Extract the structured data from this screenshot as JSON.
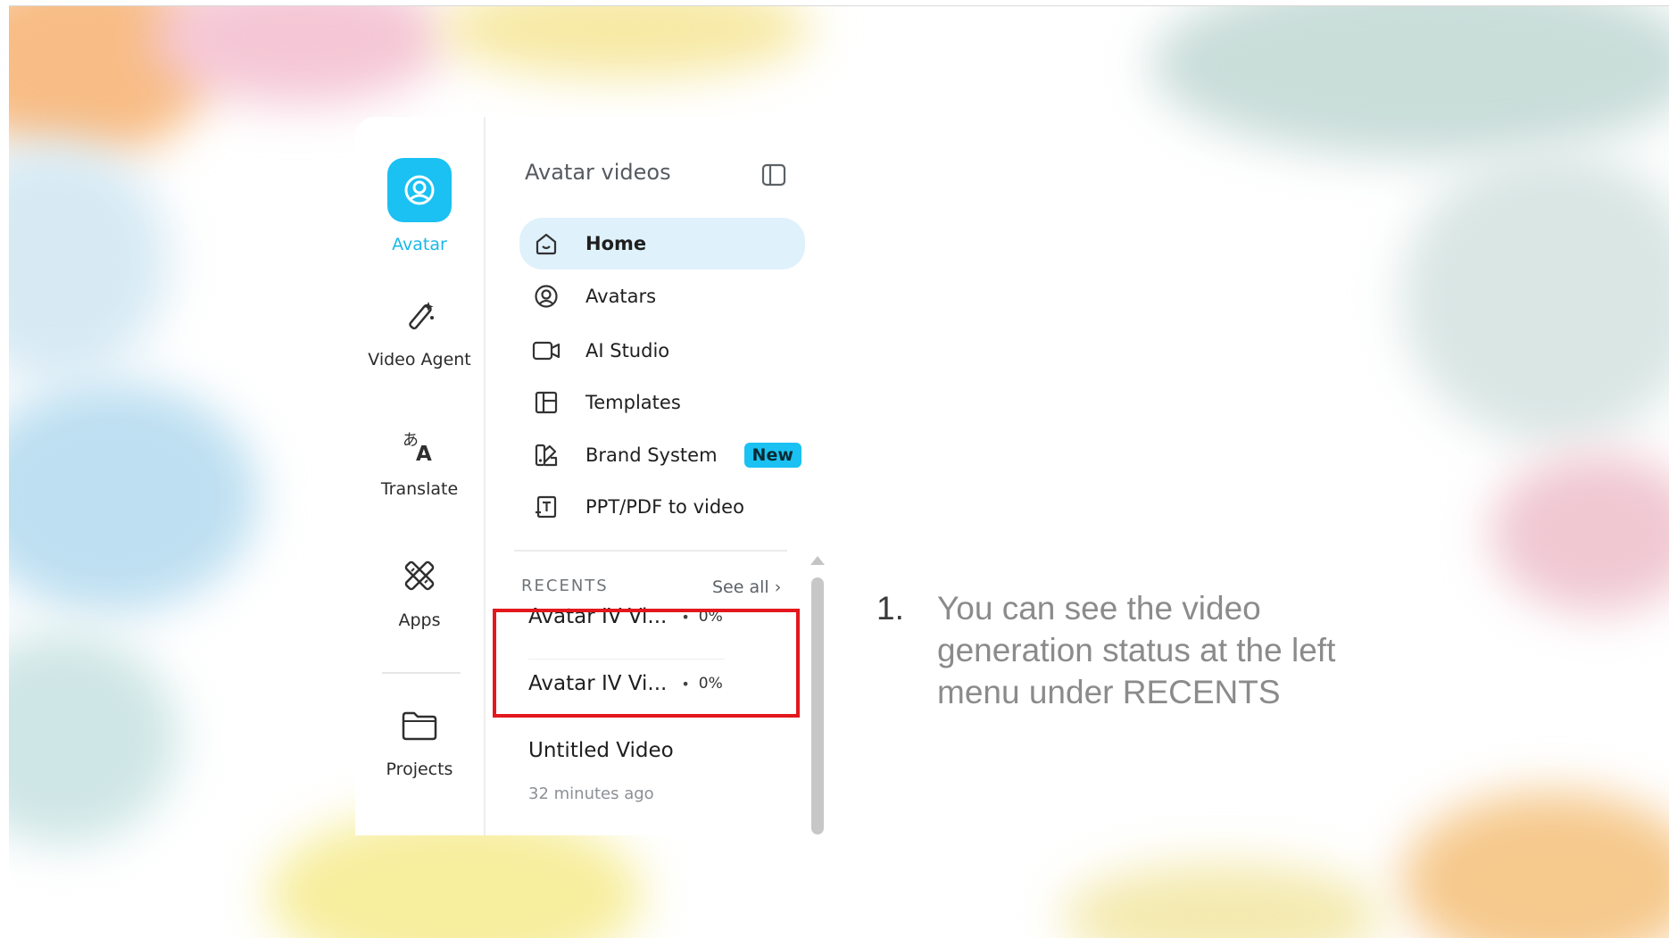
{
  "sidebar": {
    "rail": [
      {
        "label": "Avatar",
        "icon": "avatar-icon",
        "active": true
      },
      {
        "label": "Video Agent",
        "icon": "magic-wand-icon"
      },
      {
        "label": "Translate",
        "icon": "translate-icon"
      },
      {
        "label": "Apps",
        "icon": "apps-icon"
      },
      {
        "label": "Projects",
        "icon": "folder-icon"
      }
    ],
    "header": {
      "title": "Avatar videos",
      "collapse_icon": "sidebar-toggle-icon"
    },
    "nav": [
      {
        "label": "Home",
        "icon": "home-icon",
        "active": true
      },
      {
        "label": "Avatars",
        "icon": "avatar-circle-icon"
      },
      {
        "label": "AI Studio",
        "icon": "video-camera-icon"
      },
      {
        "label": "Templates",
        "icon": "template-layout-icon"
      },
      {
        "label": "Brand System",
        "icon": "brand-kit-icon",
        "badge": "New"
      },
      {
        "label": "PPT/PDF to video",
        "icon": "document-upload-icon"
      }
    ],
    "recents": {
      "title": "RECENTS",
      "see_all": "See all ›",
      "items": [
        {
          "name": "Avatar IV Vi...",
          "dot": "•",
          "progress": "0%"
        },
        {
          "name": "Avatar IV Vi...",
          "dot": "•",
          "progress": "0%"
        },
        {
          "name": "Untitled Video",
          "time": "32 minutes ago"
        }
      ]
    }
  },
  "instruction": {
    "number": "1.",
    "text": "You can see the video generation status at the left menu under RECENTS"
  },
  "colors": {
    "accent": "#1ac1f2",
    "highlight_box": "#e3171d",
    "active_nav_bg": "#dff1fb"
  }
}
